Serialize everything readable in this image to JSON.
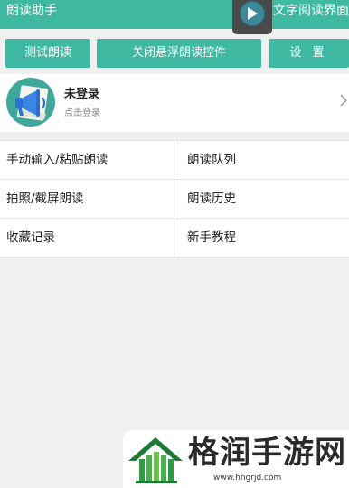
{
  "header": {
    "title": "朗读助手",
    "right_text": "文字阅读界面"
  },
  "float_widget": {
    "icon": "play-icon"
  },
  "toolbar": {
    "test_label": "测试朗读",
    "close_float_label": "关闭悬浮朗读控件",
    "settings_label": "设 置"
  },
  "user": {
    "name": "未登录",
    "subtitle": "点击登录",
    "avatar_icon": "megaphone-icon",
    "arrow_icon": "chevron-right-icon"
  },
  "menu": {
    "manual_input": "手动输入/粘贴朗读",
    "queue": "朗读队列",
    "photo": "拍照/截屏朗读",
    "history": "朗读历史",
    "favorites": "收藏记录",
    "tutorial": "新手教程"
  },
  "watermark": {
    "brand": "格润手游网",
    "url": "www.hngrjd.com"
  },
  "colors": {
    "accent": "#3fb9a2",
    "background": "#f0f0f0"
  }
}
